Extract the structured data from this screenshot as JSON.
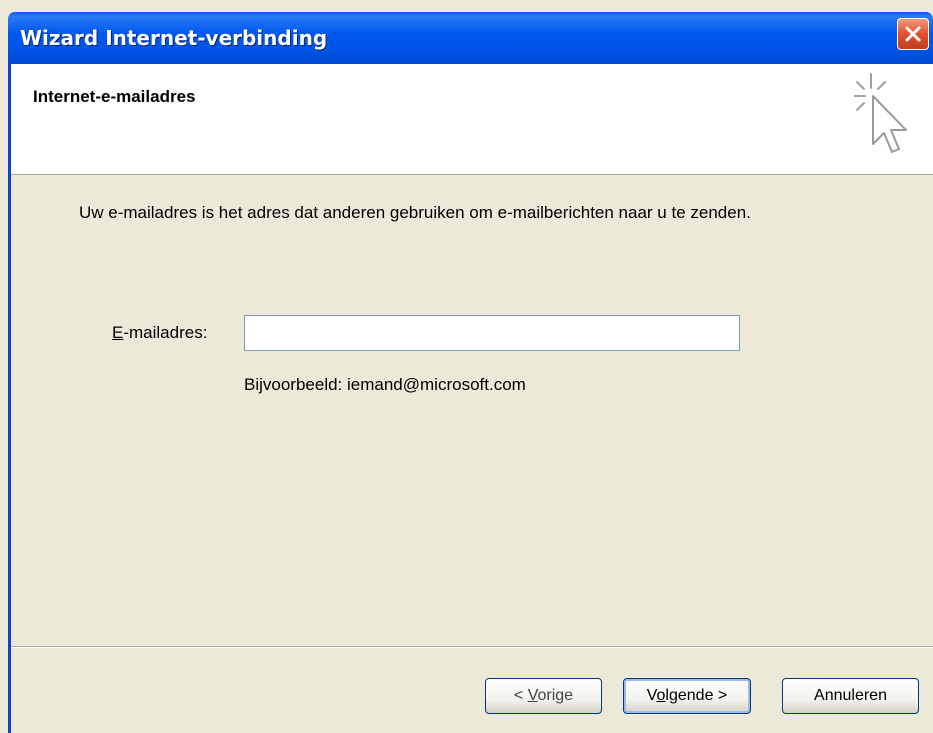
{
  "window": {
    "title": "Wizard Internet-verbinding"
  },
  "header": {
    "title": "Internet-e-mailadres",
    "icon": "wizard-cursor-icon"
  },
  "body": {
    "intro": "Uw e-mailadres is het adres dat anderen gebruiken om e-mailberichten naar u te zenden.",
    "email_label_accel": "E",
    "email_label_rest": "-mailadres:",
    "email_value": "",
    "example": "Bijvoorbeeld: iemand@microsoft.com"
  },
  "footer": {
    "back_pre": "< ",
    "back_accel": "V",
    "back_rest": "orige",
    "next_pre": "V",
    "next_accel": "o",
    "next_rest": "lgende >",
    "cancel_label": "Annuleren"
  },
  "colors": {
    "titlebar": "#0054e8",
    "dialog_bg": "#ece9d8",
    "close_button": "#e0502f"
  }
}
